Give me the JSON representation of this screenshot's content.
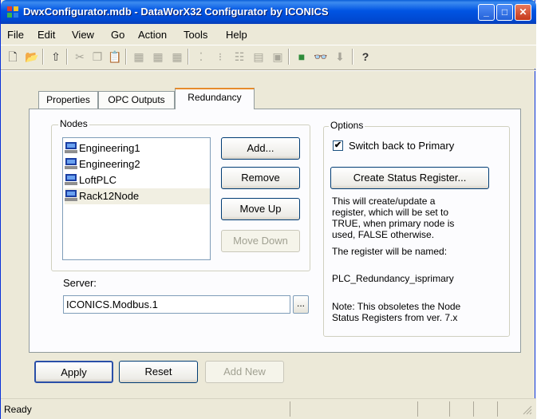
{
  "window": {
    "title": "DwxConfigurator.mdb - DataWorX32 Configurator by ICONICS",
    "controls": {
      "minimize": "_",
      "maximize": "□",
      "close": "✕"
    }
  },
  "menu": {
    "items": [
      {
        "name": "file",
        "label": "File"
      },
      {
        "name": "edit",
        "label": "Edit"
      },
      {
        "name": "view",
        "label": "View"
      },
      {
        "name": "go",
        "label": "Go"
      },
      {
        "name": "action",
        "label": "Action"
      },
      {
        "name": "tools",
        "label": "Tools"
      },
      {
        "name": "help",
        "label": "Help"
      }
    ]
  },
  "toolbar": {
    "icons": [
      "new-document-icon",
      "open-folder-icon",
      "up-folder-icon",
      "cut-icon",
      "copy-icon",
      "paste-icon",
      "add-item-icon",
      "add-group-icon",
      "add-tag-icon",
      "small-icons-view-icon",
      "list-view-icon",
      "details-view-icon",
      "grid-view-icon",
      "properties-view-icon",
      "traffic-light-icon",
      "binoculars-icon",
      "download-icon",
      "help-icon"
    ]
  },
  "tabs": [
    {
      "name": "properties",
      "label": "Properties",
      "active": false
    },
    {
      "name": "opc-outputs",
      "label": "OPC Outputs",
      "active": false
    },
    {
      "name": "redundancy",
      "label": "Redundancy",
      "active": true
    }
  ],
  "nodes": {
    "group_label": "Nodes",
    "items": [
      {
        "label": "Engineering1",
        "selected": false
      },
      {
        "label": "Engineering2",
        "selected": false
      },
      {
        "label": "LoftPLC",
        "selected": false
      },
      {
        "label": "Rack12Node",
        "selected": true
      }
    ],
    "buttons": {
      "add": "Add...",
      "remove": "Remove",
      "move_up": "Move Up",
      "move_down": "Move Down"
    }
  },
  "server": {
    "label": "Server:",
    "value": "ICONICS.Modbus.1",
    "browse_label": "..."
  },
  "options": {
    "group_label": "Options",
    "switch_back_label": "Switch back to Primary",
    "switch_back_checked": true,
    "create_status_label": "Create Status Register...",
    "description_lines": [
      "This will create/update a",
      "register, which will be set to",
      "TRUE, when primary node is",
      "used, FALSE otherwise."
    ],
    "named_label": "The register will be named:",
    "register_name": "PLC_Redundancy_isprimary",
    "note_lines": [
      "Note: This obsoletes the Node",
      "Status Registers from ver. 7.x"
    ]
  },
  "footer_buttons": {
    "apply": "Apply",
    "reset": "Reset",
    "add_new": "Add New"
  },
  "statusbar": {
    "text": "Ready"
  }
}
